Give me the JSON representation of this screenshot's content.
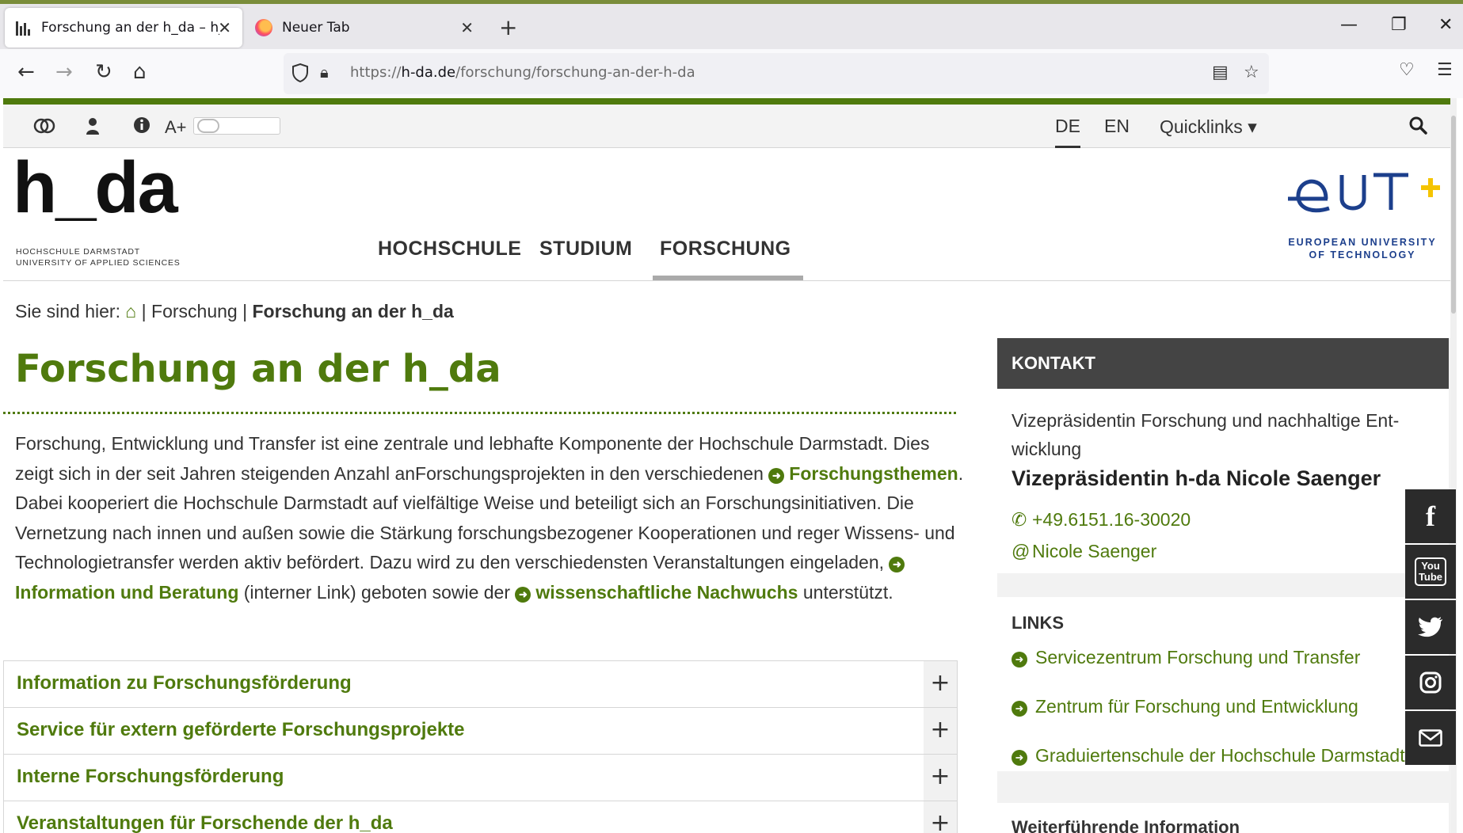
{
  "browser": {
    "tabs": [
      {
        "title": "Forschung an der h_da – h_da H",
        "close": "✕"
      },
      {
        "title": "Neuer Tab",
        "close": "✕"
      }
    ],
    "new_tab": "+",
    "window_controls": {
      "minimize": "—",
      "maximize": "❐",
      "close": "✕"
    },
    "url": {
      "prefix": "https://",
      "host": "h-da.de",
      "path": "/forschung/forschung-an-der-h-da"
    }
  },
  "utility_bar": {
    "font_size_label": "A+",
    "languages": [
      {
        "code": "DE",
        "active": true
      },
      {
        "code": "EN",
        "active": false
      }
    ],
    "quicklinks_label": "Quicklinks ▾"
  },
  "header": {
    "logo_text": "h_da",
    "logo_sub_1": "HOCHSCHULE DARMSTADT",
    "logo_sub_2": "UNIVERSITY OF APPLIED SCIENCES",
    "nav": [
      "HOCHSCHULE",
      "STUDIUM",
      "FORSCHUNG"
    ],
    "nav_active": "FORSCHUNG",
    "eut_line_1": "EUROPEAN UNIVERSITY",
    "eut_line_2": "OF TECHNOLOGY"
  },
  "breadcrumb": {
    "prefix": "Sie sind hier:",
    "items": [
      "Forschung",
      "Forschung an der h_da"
    ]
  },
  "main": {
    "title": "Forschung an der h_da",
    "intro": {
      "t1": "Forschung, Entwicklung und Transfer ist eine zentrale und lebhafte Komponente der Hochschule Darmstadt. Dies zeigt sich in der seit Jahren steigenden Anzahl anForschungsprojekten in den verschiedenen ",
      "link1": "For­schungsthemen",
      "t2": ". Dabei kooperiert die Hochschule Darmstadt auf vielfältige Weise und beteiligt sich an For­schungsinitiativen. Die Vernetzung nach innen und außen sowie die Stärkung forschungsbezogener Koopera­tionen und reger Wissens- und Technologietransfer werden aktiv befördert. Dazu wird zu den verschiedensten Veranstaltungen eingeladen, ",
      "link2": "Information und Beratung",
      "t3": " (interner Link) geboten sowie der ",
      "link3": "wissen­schaftliche Nachwuchs",
      "t4": " unterstützt."
    },
    "accordion": [
      "Information zu Forschungsförderung",
      "Service für extern geförderte Forschungsprojekte",
      "Interne Forschungsförderung",
      "Veranstaltungen für Forschende der h_da"
    ]
  },
  "sidebar": {
    "kontakt": {
      "title": "KONTAKT",
      "role": "Vizepräsidentin Forschung und nachhaltige Ent­wicklung",
      "name": "Vizepräsidentin h-da Nicole Saenger",
      "phone": "+49.6151.16-30020",
      "email": "Nicole Saenger"
    },
    "links": {
      "title": "LINKS",
      "items": [
        "Servicezentrum Forschung und Transfer",
        "Zentrum für Forschung und Entwicklung",
        "Graduiertenschule der Hochschule Darmstadt"
      ]
    },
    "more_title": "Weiterführende Information"
  },
  "social": [
    "facebook-icon",
    "youtube-icon",
    "twitter-icon",
    "instagram-icon",
    "mail-icon"
  ],
  "colors": {
    "brand_green": "#4f7a0d",
    "dark": "#444444"
  }
}
